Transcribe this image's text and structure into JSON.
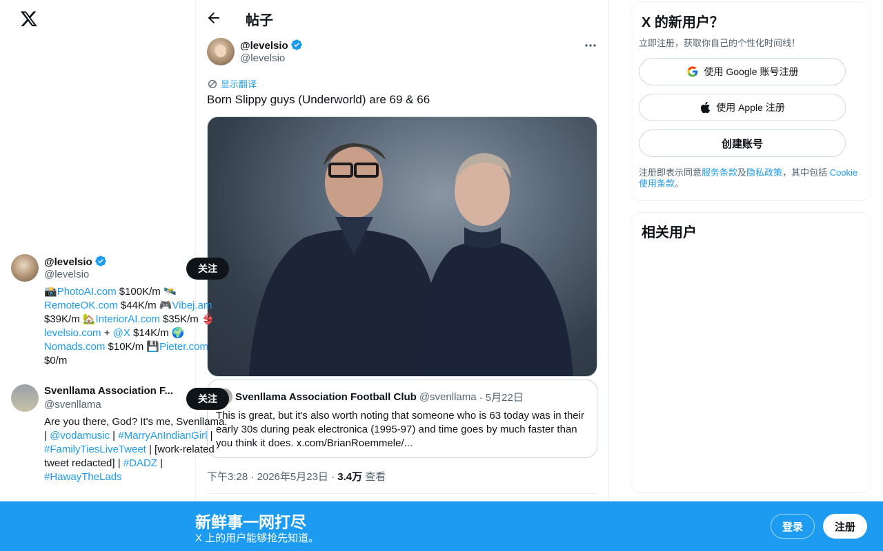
{
  "header": {
    "title": "帖子"
  },
  "tweet": {
    "author_name": "@levelsio",
    "author_handle": "@levelsio",
    "translate_label": "显示翻译",
    "text": "Born Slippy guys (Underworld) are 69 & 66",
    "quote": {
      "name": "Svenllama Association Football Club",
      "handle": "@svenllama",
      "date": "· 5月22日",
      "text": "This is great, but it's also worth noting that someone who is 63 today was in their early 30s during peak electronica (1995-97) and time goes by much faster than you think it does. x.com/BrianRoemmele/..."
    },
    "meta": {
      "time": "下午3:28 · 2026年5月23日 · ",
      "views": "3.4万",
      "views_label": " 查看"
    }
  },
  "signup": {
    "title": "X 的新用户？",
    "subtitle": "立即注册，获取你自己的个性化时间线！",
    "google_label": "使用 Google 账号注册",
    "apple_label": "使用 Apple 注册",
    "create_label": "创建账号",
    "terms_prefix": "注册即表示同意",
    "terms_link": "服务条款",
    "terms_and": "及",
    "privacy_link": "隐私政策",
    "terms_mid": "，其中包括 ",
    "cookie_link": "Cookie 使用条款",
    "terms_end": "。"
  },
  "related": {
    "title": "相关用户",
    "follow_label": "关注",
    "users": [
      {
        "name": "@levelsio",
        "handle": "@levelsio",
        "bio": [
          {
            "t": "📸"
          },
          {
            "l": "PhotoAI.com"
          },
          {
            "t": " $100K/m 🛰️ "
          },
          {
            "l": "RemoteOK.com"
          },
          {
            "t": " $44K/m 🎮"
          },
          {
            "l": "Vibej.am"
          },
          {
            "t": " $39K/m 🏡"
          },
          {
            "l": "InteriorAI.com"
          },
          {
            "t": " $35K/m 👙 "
          },
          {
            "l": "levelsio.com"
          },
          {
            "t": " + "
          },
          {
            "l": "@X"
          },
          {
            "t": " $14K/m 🌍 "
          },
          {
            "l": "Nomads.com"
          },
          {
            "t": " $10K/m 💾"
          },
          {
            "l": "Pieter.com"
          },
          {
            "t": " $0/m"
          }
        ]
      },
      {
        "name": "Svenllama Association F...",
        "handle": "@svenllama",
        "bio": [
          {
            "t": "Are you there, God? It's me, Svenllama. | "
          },
          {
            "l": "@vodamusic"
          },
          {
            "t": " | "
          },
          {
            "l": "#MarryAnIndianGirl"
          },
          {
            "t": " | "
          },
          {
            "l": "#FamilyTiesLiveTweet"
          },
          {
            "t": " | [work-related tweet redacted] | "
          },
          {
            "l": "#DADZ"
          },
          {
            "t": " | "
          },
          {
            "l": "#HawayTheLads"
          }
        ]
      }
    ]
  },
  "banner": {
    "title": "新鲜事一网打尽",
    "subtitle": "X 上的用户能够抢先知道。",
    "login_label": "登录",
    "register_label": "注册"
  },
  "colors": {
    "accent": "#1d9bf0",
    "text": "#0f1419",
    "muted": "#536471",
    "border": "#cfd9de"
  }
}
